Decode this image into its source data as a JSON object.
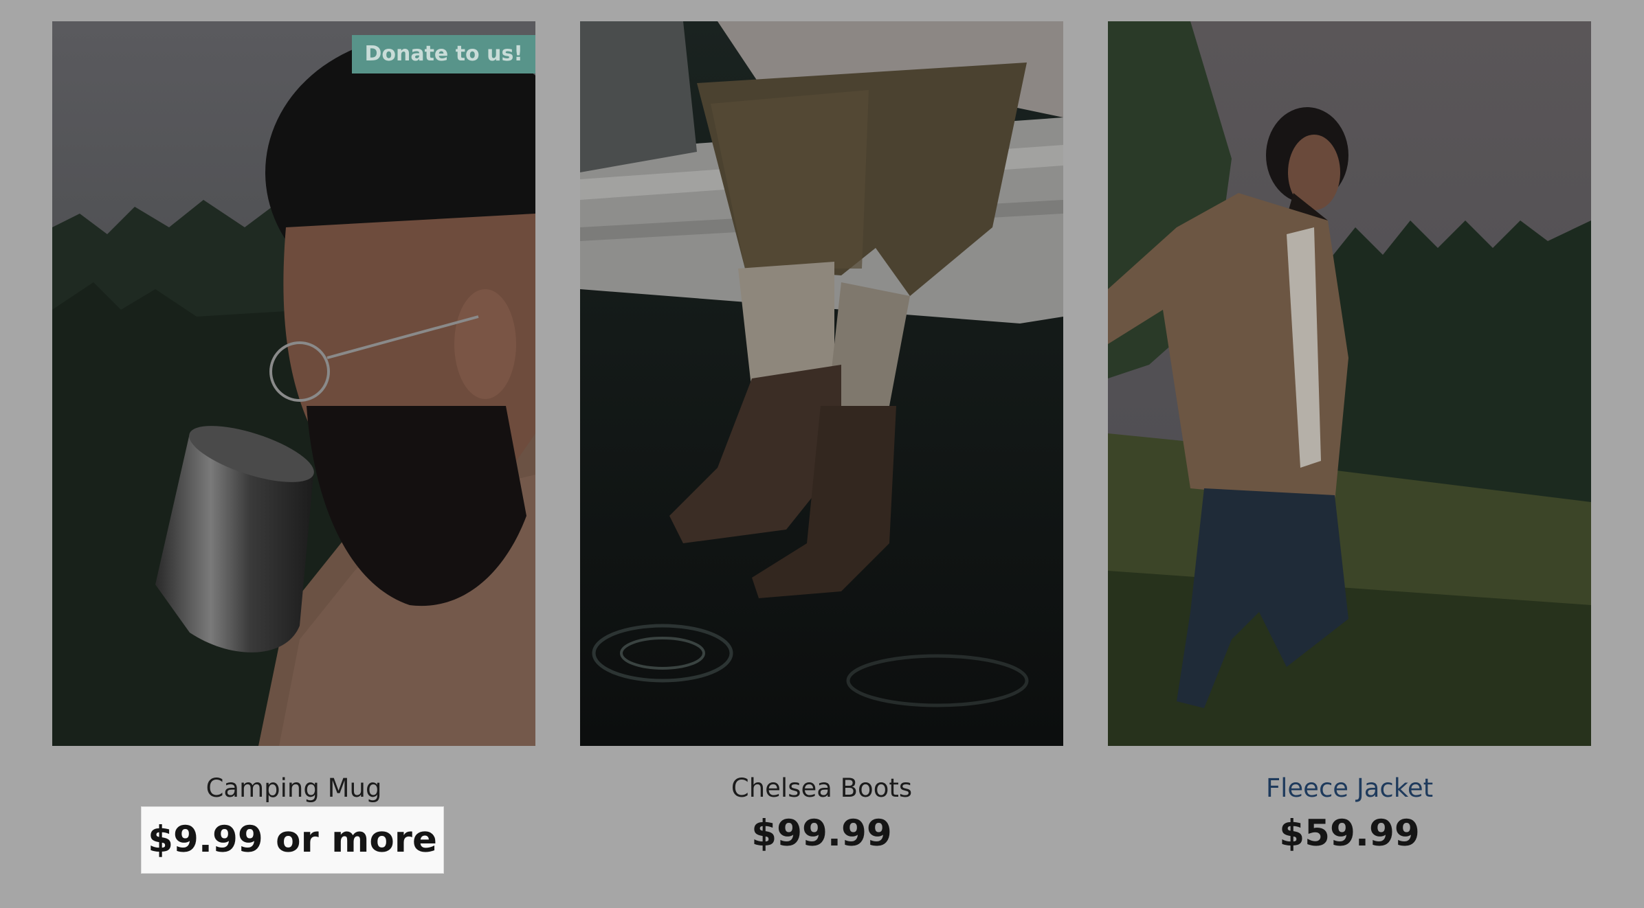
{
  "products": [
    {
      "id": "mug",
      "title": "Camping Mug",
      "price": "$9.99 or more",
      "badge": "Donate to us!",
      "image_icon": "photo-man-drinking-from-mug"
    },
    {
      "id": "boots",
      "title": "Chelsea Boots",
      "price": "$99.99",
      "image_icon": "photo-boots-over-water"
    },
    {
      "id": "jacket",
      "title": "Fleece Jacket",
      "price": "$59.99",
      "image_icon": "photo-man-walking-in-fleece"
    }
  ],
  "colors": {
    "overlay_background": "#a6a6a6",
    "badge": "#58948a",
    "highlight_box": "#f9f9f9",
    "link_title": "#1e3a5c"
  }
}
